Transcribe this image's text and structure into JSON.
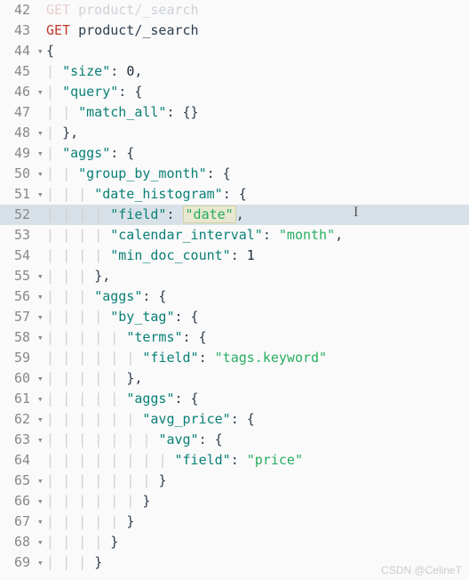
{
  "gutter_start": 42,
  "watermark": "CSDN @CelineT",
  "tokens": {
    "get": "GET",
    "path": "product/_search",
    "size": "\"size\"",
    "zero": "0",
    "query": "\"query\"",
    "match_all": "\"match_all\"",
    "aggs": "\"aggs\"",
    "group_by_month": "\"group_by_month\"",
    "date_histogram": "\"date_histogram\"",
    "field": "\"field\"",
    "date": "\"date\"",
    "calendar_interval": "\"calendar_interval\"",
    "month": "\"month\"",
    "min_doc_count": "\"min_doc_count\"",
    "one": "1",
    "by_tag": "\"by_tag\"",
    "terms": "\"terms\"",
    "tags_keyword": "\"tags.keyword\"",
    "avg_price": "\"avg_price\"",
    "avg": "\"avg\"",
    "price": "\"price\""
  },
  "prev_line_trail": "product/_search",
  "lines": [
    {
      "num": 42,
      "fold": "",
      "indent": 0,
      "segments": [
        [
          "prev-faint",
          ""
        ]
      ]
    },
    {
      "num": 43,
      "fold": "",
      "indent": 0,
      "segments": [
        [
          "method",
          "get"
        ],
        [
          "space",
          " "
        ],
        [
          "url",
          "path"
        ]
      ]
    },
    {
      "num": 44,
      "fold": "▾",
      "indent": 0,
      "segments": [
        [
          "punct-lit",
          "{"
        ]
      ]
    },
    {
      "num": 45,
      "fold": "",
      "indent": 1,
      "segments": [
        [
          "key",
          "size"
        ],
        [
          "punct-lit",
          ": "
        ],
        [
          "num",
          "zero"
        ],
        [
          "punct-lit",
          ","
        ]
      ]
    },
    {
      "num": 46,
      "fold": "▾",
      "indent": 1,
      "segments": [
        [
          "key",
          "query"
        ],
        [
          "punct-lit",
          ": {"
        ]
      ]
    },
    {
      "num": 47,
      "fold": "",
      "indent": 2,
      "segments": [
        [
          "key",
          "match_all"
        ],
        [
          "punct-lit",
          ": {}"
        ]
      ]
    },
    {
      "num": 48,
      "fold": "▾",
      "indent": 1,
      "segments": [
        [
          "punct-lit",
          "},"
        ]
      ]
    },
    {
      "num": 49,
      "fold": "▾",
      "indent": 1,
      "segments": [
        [
          "key",
          "aggs"
        ],
        [
          "punct-lit",
          ": {"
        ]
      ]
    },
    {
      "num": 50,
      "fold": "▾",
      "indent": 2,
      "segments": [
        [
          "key",
          "group_by_month"
        ],
        [
          "punct-lit",
          ": {"
        ]
      ]
    },
    {
      "num": 51,
      "fold": "▾",
      "indent": 3,
      "segments": [
        [
          "key",
          "date_histogram"
        ],
        [
          "punct-lit",
          ": {"
        ]
      ]
    },
    {
      "num": 52,
      "fold": "",
      "indent": 4,
      "highlight": true,
      "segments": [
        [
          "key",
          "field"
        ],
        [
          "punct-lit",
          ": "
        ],
        [
          "strbox",
          "date"
        ],
        [
          "punct-lit",
          ","
        ]
      ]
    },
    {
      "num": 53,
      "fold": "",
      "indent": 4,
      "segments": [
        [
          "key",
          "calendar_interval"
        ],
        [
          "punct-lit",
          ": "
        ],
        [
          "str",
          "month"
        ],
        [
          "punct-lit",
          ","
        ]
      ]
    },
    {
      "num": 54,
      "fold": "",
      "indent": 4,
      "segments": [
        [
          "key",
          "min_doc_count"
        ],
        [
          "punct-lit",
          ": "
        ],
        [
          "num",
          "one"
        ]
      ]
    },
    {
      "num": 55,
      "fold": "▾",
      "indent": 3,
      "segments": [
        [
          "punct-lit",
          "},"
        ]
      ]
    },
    {
      "num": 56,
      "fold": "▾",
      "indent": 3,
      "segments": [
        [
          "key",
          "aggs"
        ],
        [
          "punct-lit",
          ": {"
        ]
      ]
    },
    {
      "num": 57,
      "fold": "▾",
      "indent": 4,
      "segments": [
        [
          "key",
          "by_tag"
        ],
        [
          "punct-lit",
          ": {"
        ]
      ]
    },
    {
      "num": 58,
      "fold": "▾",
      "indent": 5,
      "segments": [
        [
          "key",
          "terms"
        ],
        [
          "punct-lit",
          ": {"
        ]
      ]
    },
    {
      "num": 59,
      "fold": "",
      "indent": 6,
      "segments": [
        [
          "key",
          "field"
        ],
        [
          "punct-lit",
          ": "
        ],
        [
          "str",
          "tags_keyword"
        ]
      ]
    },
    {
      "num": 60,
      "fold": "▾",
      "indent": 5,
      "segments": [
        [
          "punct-lit",
          "},"
        ]
      ]
    },
    {
      "num": 61,
      "fold": "▾",
      "indent": 5,
      "segments": [
        [
          "key",
          "aggs"
        ],
        [
          "punct-lit",
          ": {"
        ]
      ]
    },
    {
      "num": 62,
      "fold": "▾",
      "indent": 6,
      "segments": [
        [
          "key",
          "avg_price"
        ],
        [
          "punct-lit",
          ": {"
        ]
      ]
    },
    {
      "num": 63,
      "fold": "▾",
      "indent": 7,
      "segments": [
        [
          "key",
          "avg"
        ],
        [
          "punct-lit",
          ": {"
        ]
      ]
    },
    {
      "num": 64,
      "fold": "",
      "indent": 8,
      "segments": [
        [
          "key",
          "field"
        ],
        [
          "punct-lit",
          ": "
        ],
        [
          "str",
          "price"
        ]
      ]
    },
    {
      "num": 65,
      "fold": "▾",
      "indent": 7,
      "segments": [
        [
          "punct-lit",
          "}"
        ]
      ]
    },
    {
      "num": 66,
      "fold": "▾",
      "indent": 6,
      "segments": [
        [
          "punct-lit",
          "}"
        ]
      ]
    },
    {
      "num": 67,
      "fold": "▾",
      "indent": 5,
      "segments": [
        [
          "punct-lit",
          "}"
        ]
      ]
    },
    {
      "num": 68,
      "fold": "▾",
      "indent": 4,
      "segments": [
        [
          "punct-lit",
          "}"
        ]
      ]
    },
    {
      "num": 69,
      "fold": "▾",
      "indent": 3,
      "segments": [
        [
          "punct-lit",
          "}"
        ]
      ]
    }
  ]
}
